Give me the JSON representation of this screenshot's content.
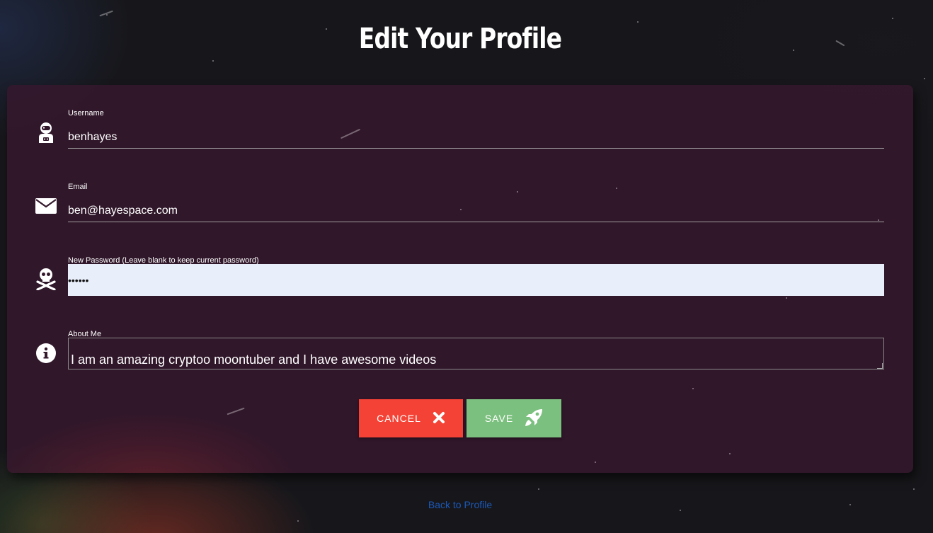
{
  "page": {
    "title": "Edit Your Profile"
  },
  "form": {
    "username": {
      "label": "Username",
      "value": "benhayes",
      "icon": "astronaut-icon"
    },
    "email": {
      "label": "Email",
      "value": "ben@hayespace.com",
      "icon": "envelope-icon"
    },
    "password": {
      "label": "New Password (Leave blank to keep current password)",
      "value": "••••••",
      "icon": "skull-crossbones-icon"
    },
    "about": {
      "label": "About Me",
      "value": "I am an amazing cryptoo moontuber and I have awesome videos",
      "icon": "info-circle-icon"
    }
  },
  "buttons": {
    "cancel_label": "CANCEL",
    "cancel_icon": "times-icon",
    "cancel_color": "#f44336",
    "save_label": "SAVE",
    "save_icon": "rocket-icon",
    "save_color": "#7cc07f"
  },
  "footer": {
    "back_link": "Back to Profile"
  },
  "colors": {
    "card_background": "#34182c",
    "link": "#1b58b8",
    "password_field_background": "#e8eefa"
  }
}
